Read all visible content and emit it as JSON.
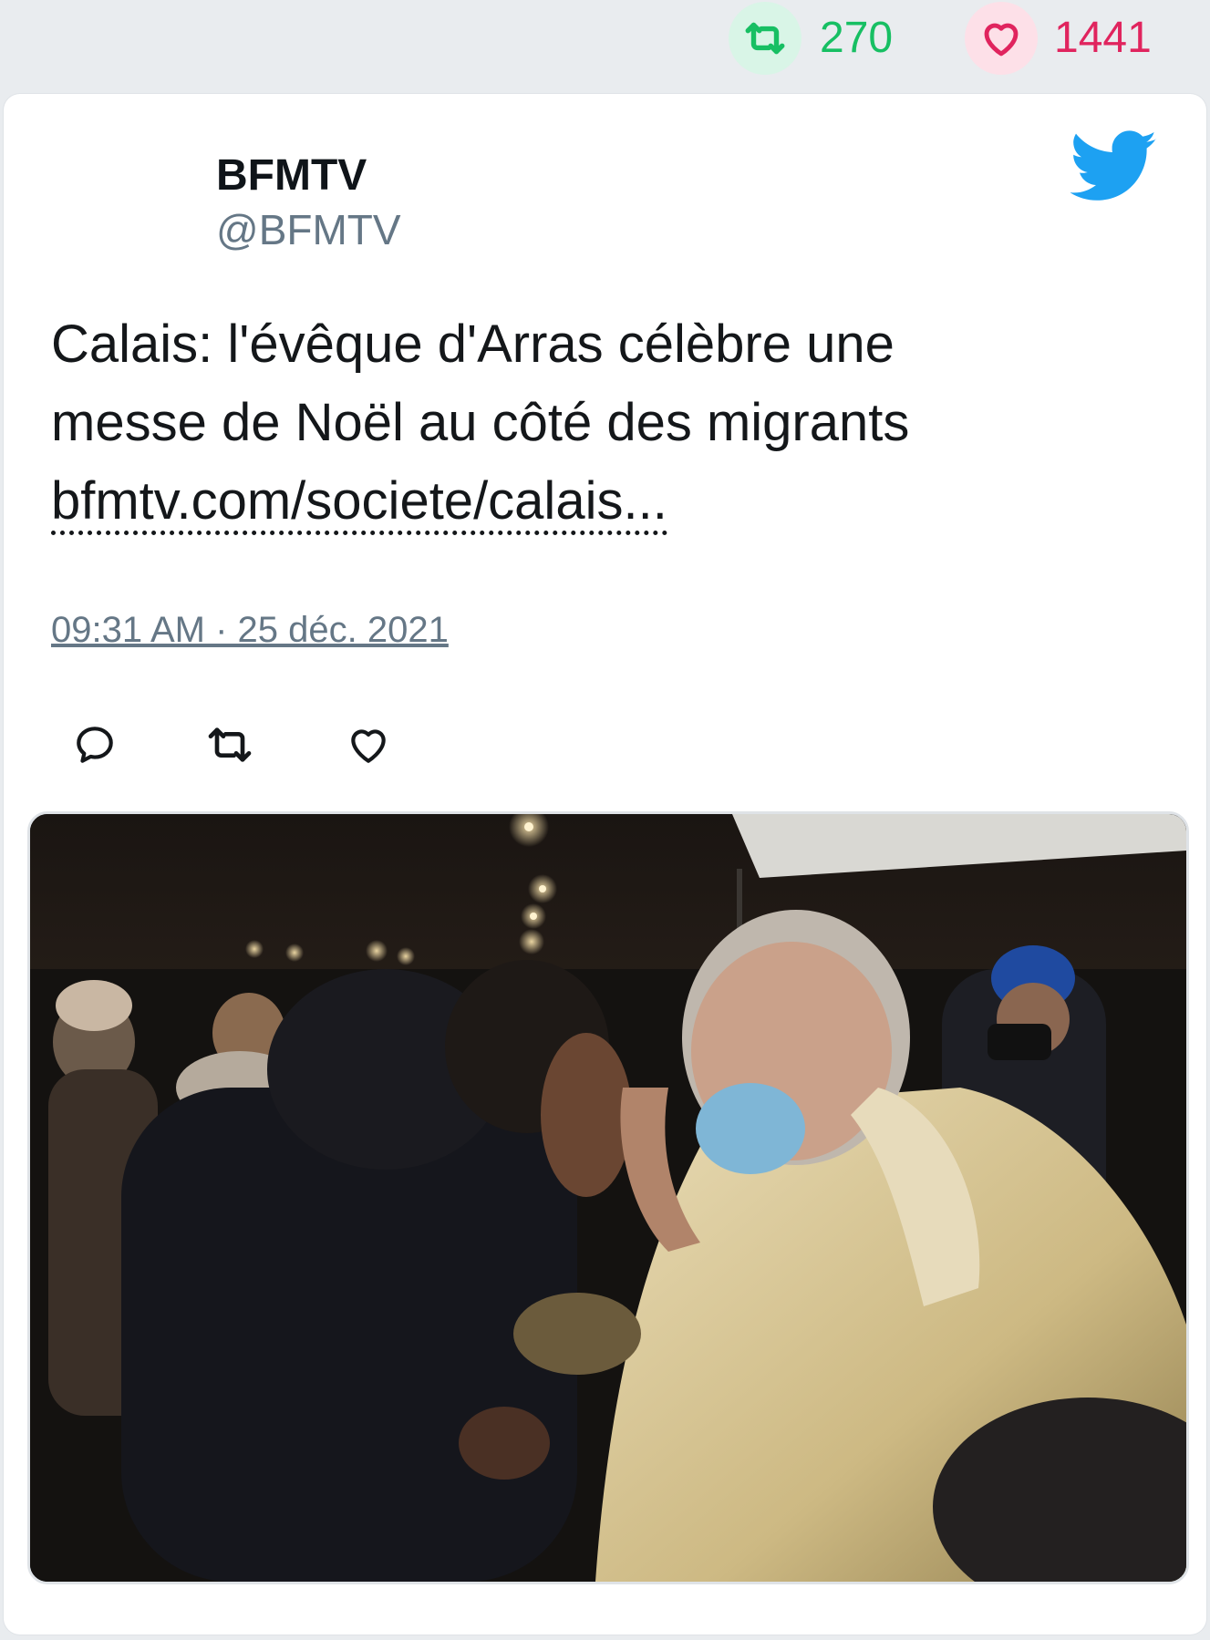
{
  "stats": {
    "retweet_count": "270",
    "like_count": "1441",
    "retweet_icon": "retweet-icon",
    "like_icon": "heart-icon"
  },
  "tweet": {
    "author_name": "BFMTV",
    "author_handle": "@BFMTV",
    "text_line1": "Calais: l'évêque d'Arras célèbre une",
    "text_line2": "messe de Noël au côté des migrants",
    "link_text": "bfmtv.com/societe/calais...",
    "timestamp": "09:31 AM · 25 déc. 2021",
    "brand_icon": "twitter-bird-icon",
    "actions": [
      "reply-icon",
      "retweet-icon",
      "like-icon"
    ]
  },
  "colors": {
    "retweet_green": "#17bf63",
    "like_red": "#e0245e",
    "twitter_blue": "#1da1f2",
    "muted_gray": "#657786"
  }
}
